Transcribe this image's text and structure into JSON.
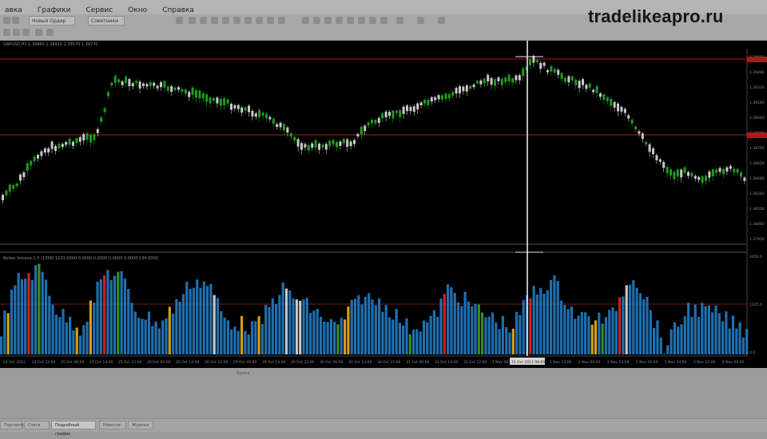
{
  "menu": [
    "авка",
    "Графики",
    "Сервис",
    "Окно",
    "Справка"
  ],
  "toolbar": {
    "new_order_label": "Новый Ордер",
    "experts_label": "Советники"
  },
  "watermark": "tradelikeapro.ru",
  "chart": {
    "window_title": "GBPUSD,H1  1.38860 1.38910 1.38570 1.38770",
    "indicator_title": "Better Volume 1.5  (1358) 1101.0000 0.0000 0.0000 0.0000 0.0000 134.0000",
    "price_labels": [
      "1.39600",
      "1.39460",
      "1.39320",
      "1.39180",
      "1.39040",
      "1.38900",
      "1.38760",
      "1.38620",
      "1.38480",
      "1.38340",
      "1.38200",
      "1.38060",
      "1.37920"
    ],
    "volume_labels": [
      "2650.0",
      "1325.0",
      "0.0"
    ],
    "time_labels": [
      "24 Oct 2012",
      "24 Oct 22:00",
      "25 Oct 06:00",
      "25 Oct 14:00",
      "25 Oct 22:00",
      "26 Oct 06:00",
      "26 Oct 14:00",
      "26 Oct 22:00",
      "29 Oct 06:00",
      "29 Oct 14:00",
      "29 Oct 22:00",
      "30 Oct 06:00",
      "30 Oct 14:00",
      "30 Oct 22:00",
      "31 Oct 06:00",
      "31 Oct 14:00",
      "31 Oct 22:00",
      "1 Nov 06:00",
      "1 Nov 14:00",
      "1 Nov 22:00",
      "2 Nov 06:00",
      "2 Nov 14:00",
      "5 Nov 06:00",
      "5 Nov 14:00",
      "5 Nov 22:00",
      "6 Nov 06:00"
    ],
    "crosshair_time": "31 Oct 2012 08:00",
    "colors": {
      "bull": "#1f9b1f",
      "bear": "#c8c8c8",
      "line": "#b01818",
      "vol_blue": "#1f6fb0",
      "vol_red": "#cc2222",
      "vol_gold": "#d4a017",
      "vol_green": "#3a8a2a",
      "vol_white": "#c8c8c8"
    }
  },
  "bottom_label": "Время",
  "tabs": [
    "Торговля",
    "Счета",
    "Подробный график",
    "Новости",
    "Журнал"
  ]
}
